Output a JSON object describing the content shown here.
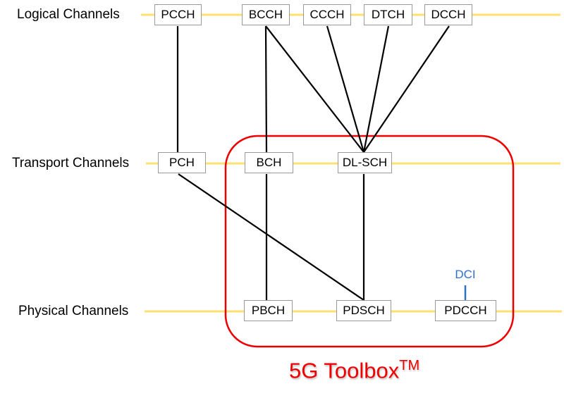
{
  "rows": {
    "logical": "Logical Channels",
    "transport": "Transport Channels",
    "physical": "Physical Channels"
  },
  "nodes": {
    "pcch": "PCCH",
    "bcch": "BCCH",
    "ccch": "CCCH",
    "dtch": "DTCH",
    "dcch": "DCCH",
    "pch": "PCH",
    "bch": "BCH",
    "dlsch": "DL-SCH",
    "pbch": "PBCH",
    "pdsch": "PDSCH",
    "pdcch": "PDCCH"
  },
  "edges": [
    [
      "PCCH",
      "PCH"
    ],
    [
      "BCCH",
      "BCH"
    ],
    [
      "BCCH",
      "DL-SCH"
    ],
    [
      "CCCH",
      "DL-SCH"
    ],
    [
      "DTCH",
      "DL-SCH"
    ],
    [
      "DCCH",
      "DL-SCH"
    ],
    [
      "PCH",
      "PDSCH"
    ],
    [
      "BCH",
      "PBCH"
    ],
    [
      "DL-SCH",
      "PDSCH"
    ],
    [
      "DCI",
      "PDCCH"
    ]
  ],
  "dci_label": "DCI",
  "brand": {
    "text": "5G Toolbox",
    "superscript": "TM"
  },
  "colors": {
    "channel_line": "#ffe070",
    "highlight_box": "#ee0000",
    "dci": "#2f6fd0",
    "edge": "#000000"
  }
}
